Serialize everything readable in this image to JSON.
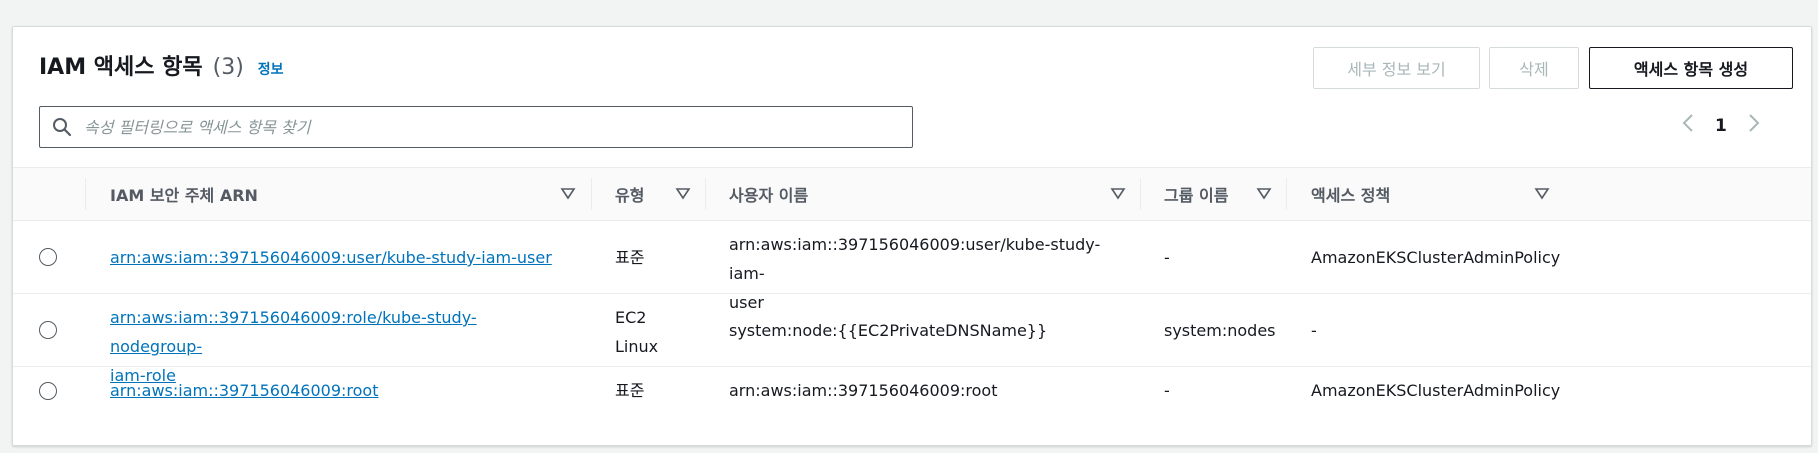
{
  "header": {
    "title": "IAM 액세스 항목",
    "count": "(3)",
    "info_label": "정보"
  },
  "actions": {
    "view_details": "세부 정보 보기",
    "delete": "삭제",
    "create": "액세스 항목 생성"
  },
  "search": {
    "placeholder": "속성 필터링으로 액세스 항목 찾기",
    "value": ""
  },
  "pagination": {
    "current_page": "1"
  },
  "table": {
    "columns": {
      "arn": "IAM 보안 주체 ARN",
      "type": "유형",
      "username": "사용자 이름",
      "group": "그룹 이름",
      "policy": "액세스 정책"
    },
    "rows": [
      {
        "arn": "arn:aws:iam::397156046009:user/kube-study-iam-user",
        "type": "표준",
        "username_line1": "arn:aws:iam::397156046009:user/kube-study-iam-",
        "username_line2": "user",
        "group": "-",
        "policy": "AmazonEKSClusterAdminPolicy"
      },
      {
        "arn_line1": "arn:aws:iam::397156046009:role/kube-study-nodegroup-",
        "arn_line2": "iam-role",
        "type_line1": "EC2",
        "type_line2": "Linux",
        "username": "system:node:{{EC2PrivateDNSName}}",
        "group": "system:nodes",
        "policy": "-"
      },
      {
        "arn": "arn:aws:iam::397156046009:root",
        "type": "표준",
        "username": "arn:aws:iam::397156046009:root",
        "group": "-",
        "policy": "AmazonEKSClusterAdminPolicy"
      }
    ]
  },
  "colors": {
    "link": "#0073bb",
    "text": "#16191f",
    "muted": "#545b64",
    "disabled": "#aab7b8",
    "border": "#eaeded"
  },
  "icons": [
    "search-icon",
    "sort-icon",
    "chevron-left-icon",
    "chevron-right-icon",
    "radio-icon"
  ]
}
